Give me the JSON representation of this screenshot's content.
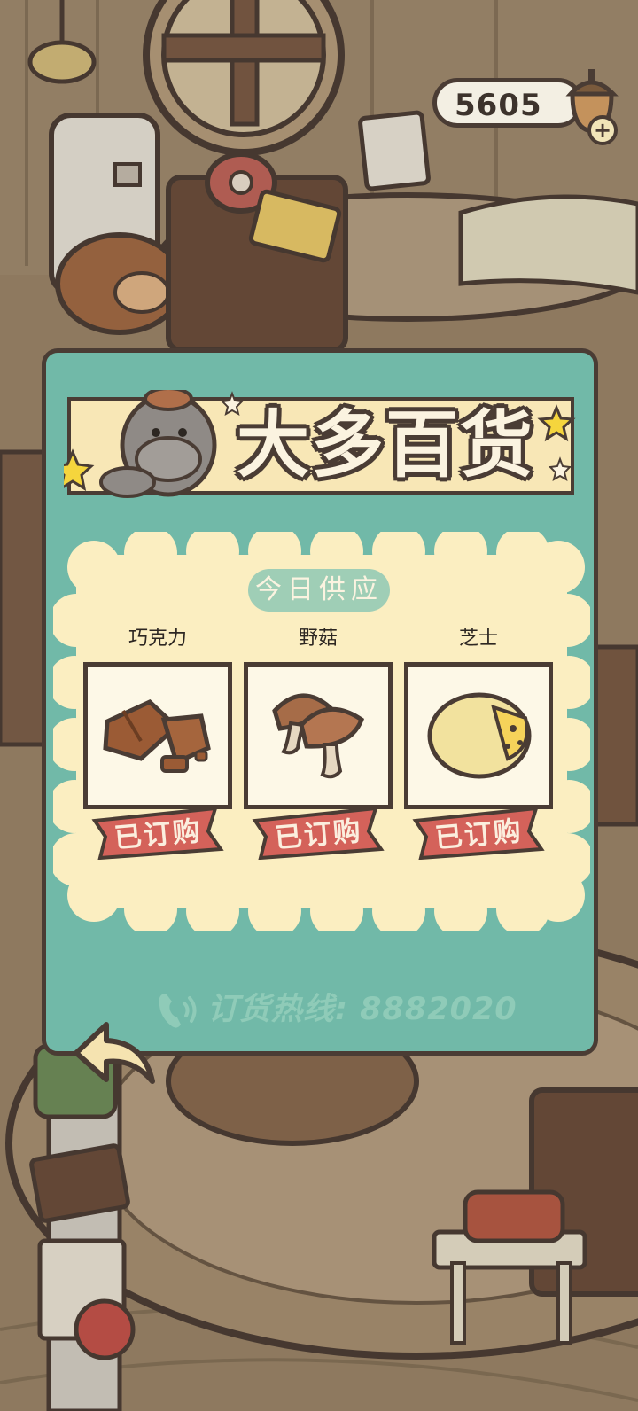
{
  "currency": {
    "amount": "5605"
  },
  "shop": {
    "title": "大多百货"
  },
  "supply": {
    "label": "今日供应"
  },
  "items": [
    {
      "name": "巧克力",
      "status": "已订购"
    },
    {
      "name": "野菇",
      "status": "已订购"
    },
    {
      "name": "芝士",
      "status": "已订购"
    }
  ],
  "hotline": {
    "text": "订货热线: 8882020"
  },
  "colors": {
    "panel": "#71b9a8",
    "banner": "#f8e7b6",
    "card": "#fbeec1",
    "badge": "#d4625a",
    "outline": "#4a3c34"
  }
}
